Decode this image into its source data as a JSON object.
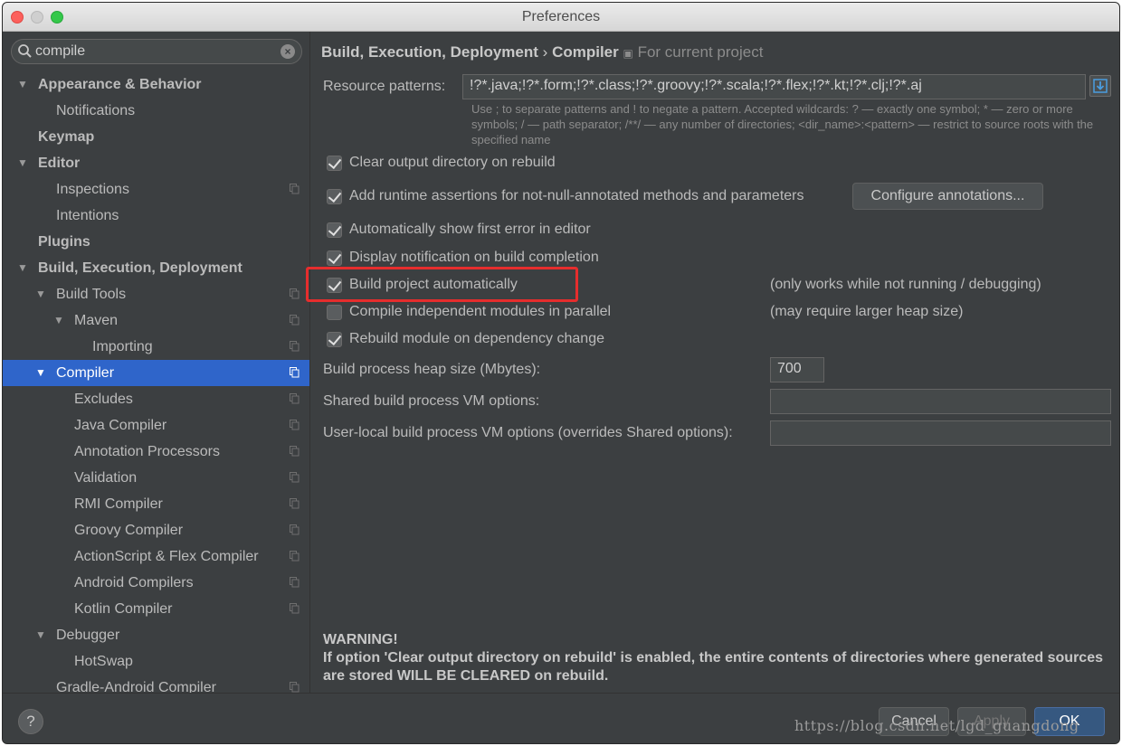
{
  "window": {
    "title": "Preferences"
  },
  "search": {
    "value": "compile"
  },
  "tree": [
    {
      "label": "Appearance & Behavior",
      "bold": true,
      "arrow": "▼",
      "indent": 0,
      "copy": false,
      "selected": false
    },
    {
      "label": "Notifications",
      "bold": false,
      "arrow": "",
      "indent": 1,
      "copy": false,
      "selected": false
    },
    {
      "label": "Keymap",
      "bold": true,
      "arrow": "",
      "indent": 0,
      "copy": false,
      "selected": false
    },
    {
      "label": "Editor",
      "bold": true,
      "arrow": "▼",
      "indent": 0,
      "copy": false,
      "selected": false
    },
    {
      "label": "Inspections",
      "bold": false,
      "arrow": "",
      "indent": 1,
      "copy": true,
      "selected": false
    },
    {
      "label": "Intentions",
      "bold": false,
      "arrow": "",
      "indent": 1,
      "copy": false,
      "selected": false
    },
    {
      "label": "Plugins",
      "bold": true,
      "arrow": "",
      "indent": 0,
      "copy": false,
      "selected": false
    },
    {
      "label": "Build, Execution, Deployment",
      "bold": true,
      "arrow": "▼",
      "indent": 0,
      "copy": false,
      "selected": false
    },
    {
      "label": "Build Tools",
      "bold": false,
      "arrow": "▼",
      "indent": 1,
      "copy": true,
      "selected": false
    },
    {
      "label": "Maven",
      "bold": false,
      "arrow": "▼",
      "indent": 2,
      "copy": true,
      "selected": false
    },
    {
      "label": "Importing",
      "bold": false,
      "arrow": "",
      "indent": 3,
      "copy": true,
      "selected": false
    },
    {
      "label": "Compiler",
      "bold": false,
      "arrow": "▼",
      "indent": 1,
      "copy": true,
      "selected": true
    },
    {
      "label": "Excludes",
      "bold": false,
      "arrow": "",
      "indent": 2,
      "copy": true,
      "selected": false
    },
    {
      "label": "Java Compiler",
      "bold": false,
      "arrow": "",
      "indent": 2,
      "copy": true,
      "selected": false
    },
    {
      "label": "Annotation Processors",
      "bold": false,
      "arrow": "",
      "indent": 2,
      "copy": true,
      "selected": false
    },
    {
      "label": "Validation",
      "bold": false,
      "arrow": "",
      "indent": 2,
      "copy": true,
      "selected": false
    },
    {
      "label": "RMI Compiler",
      "bold": false,
      "arrow": "",
      "indent": 2,
      "copy": true,
      "selected": false
    },
    {
      "label": "Groovy Compiler",
      "bold": false,
      "arrow": "",
      "indent": 2,
      "copy": true,
      "selected": false
    },
    {
      "label": "ActionScript & Flex Compiler",
      "bold": false,
      "arrow": "",
      "indent": 2,
      "copy": true,
      "selected": false
    },
    {
      "label": "Android Compilers",
      "bold": false,
      "arrow": "",
      "indent": 2,
      "copy": true,
      "selected": false
    },
    {
      "label": "Kotlin Compiler",
      "bold": false,
      "arrow": "",
      "indent": 2,
      "copy": true,
      "selected": false
    },
    {
      "label": "Debugger",
      "bold": false,
      "arrow": "▼",
      "indent": 1,
      "copy": false,
      "selected": false
    },
    {
      "label": "HotSwap",
      "bold": false,
      "arrow": "",
      "indent": 2,
      "copy": false,
      "selected": false
    },
    {
      "label": "Gradle-Android Compiler",
      "bold": false,
      "arrow": "",
      "indent": 1,
      "copy": true,
      "selected": false
    }
  ],
  "breadcrumb": {
    "section": "Build, Execution, Deployment",
    "separator": "›",
    "page": "Compiler",
    "scope": "For current project"
  },
  "resource": {
    "label": "Resource patterns:",
    "value": "!?*.java;!?*.form;!?*.class;!?*.groovy;!?*.scala;!?*.flex;!?*.kt;!?*.clj;!?*.aj",
    "hint": "Use ; to separate patterns and ! to negate a pattern. Accepted wildcards: ? — exactly one symbol; * — zero or more symbols; / — path separator; /**/ — any number of directories; <dir_name>:<pattern> — restrict to source roots with the specified name"
  },
  "options": {
    "clear_output": {
      "label": "Clear output directory on rebuild",
      "checked": true
    },
    "runtime_assertions": {
      "label": "Add runtime assertions for not-null-annotated methods and parameters",
      "checked": true
    },
    "show_first_error": {
      "label": "Automatically show first error in editor",
      "checked": true
    },
    "display_notification": {
      "label": "Display notification on build completion",
      "checked": true
    },
    "build_automatically": {
      "label": "Build project automatically",
      "checked": true,
      "note": "(only works while not running / debugging)"
    },
    "compile_parallel": {
      "label": "Compile independent modules in parallel",
      "checked": false,
      "note": "(may require larger heap size)"
    },
    "rebuild_module": {
      "label": "Rebuild module on dependency change",
      "checked": true
    }
  },
  "configure_button": "Configure annotations...",
  "heap": {
    "label": "Build process heap size (Mbytes):",
    "value": "700"
  },
  "shared_vm": {
    "label": "Shared build process VM options:",
    "value": ""
  },
  "user_vm": {
    "label": "User-local build process VM options (overrides Shared options):",
    "value": ""
  },
  "warning": {
    "title": "WARNING!",
    "text": "If option 'Clear output directory on rebuild' is enabled, the entire contents of directories where generated sources are stored WILL BE CLEARED on rebuild."
  },
  "footer": {
    "help": "?",
    "cancel": "Cancel",
    "apply": "Apply",
    "ok": "OK"
  },
  "watermark": "https://blog.csdn.net/lgd_guangdong",
  "colors": {
    "selection": "#2f65ca",
    "highlight": "#e62d2d",
    "background": "#3c3f41"
  }
}
